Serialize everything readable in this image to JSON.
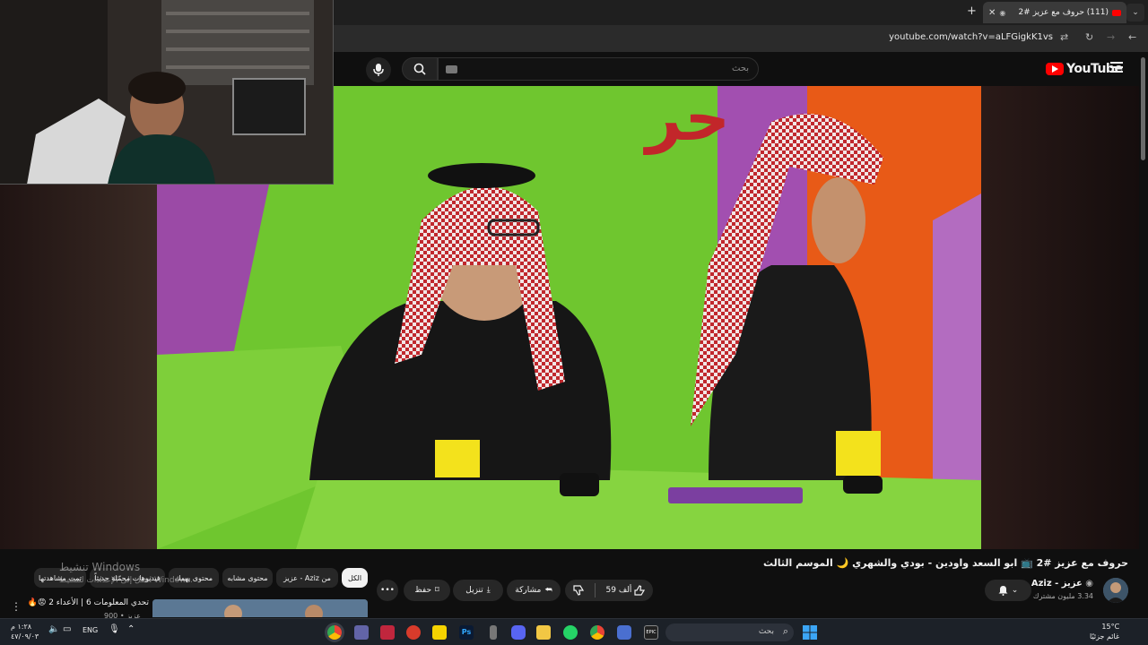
{
  "browser": {
    "tab_title": "(111) حروف مع عزيز #2",
    "url": "youtube.com/watch?v=aLFGigkK1vs",
    "new_tab": "+",
    "close": "✕"
  },
  "youtube": {
    "logo_text": "YouTube",
    "search_placeholder": "بحث"
  },
  "video": {
    "title": "حروف مع عزيز #2 📺 ابو السعد واودين - بودي والشهري 🌙 الموسم الثالث",
    "channel_name": "عزيز - Aziz",
    "subscribers": "3.34 مليون مشترك",
    "like_count": "59 ألف",
    "share_label": "مشاركة",
    "download_label": "تنزيل",
    "save_label": "حفظ"
  },
  "chips": [
    "الكل",
    "من Aziz - عزيز",
    "محتوى مشابه",
    "محتوى يهمك",
    "فيديوهات محمّلة حديثاً",
    "تمت مشاهدتها"
  ],
  "watermark": {
    "line1": "تنشيط Windows",
    "line2": "انتقل إلى الإعدادات لتنشيط Windows."
  },
  "related": {
    "title": "تحدي المعلومات 6 | الأعداء 2 😡🔥",
    "meta": "عزيز • 900"
  },
  "taskbar": {
    "search_placeholder": "بحث",
    "lang": "ENG",
    "time": "١:٢٨ م",
    "date": "٤٧/٠٩/٠٣",
    "temperature": "15°C",
    "weather_text": "غائم جزئيًا"
  },
  "colors": {
    "background": "#0f0f0f",
    "accent": "#ff0000",
    "pill": "#272727",
    "taskbar": "#1c2128"
  }
}
